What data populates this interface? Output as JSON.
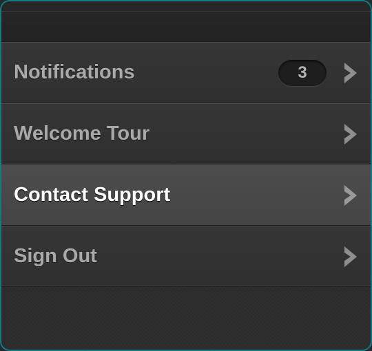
{
  "menu": {
    "items": [
      {
        "label": "Notifications",
        "badge": "3",
        "chevron": "chevron-right-icon",
        "active": false
      },
      {
        "label": "Welcome Tour",
        "chevron": "chevron-right-icon",
        "active": false
      },
      {
        "label": "Contact Support",
        "chevron": "chevron-right-icon",
        "active": true
      },
      {
        "label": "Sign Out",
        "chevron": "chevron-right-icon",
        "active": false
      }
    ]
  },
  "colors": {
    "border_accent": "#167a80",
    "background": "#2c2c2c",
    "active_row": "#4a4a4a",
    "label_text": "#a9a9a9",
    "active_label_text": "#ffffff"
  }
}
